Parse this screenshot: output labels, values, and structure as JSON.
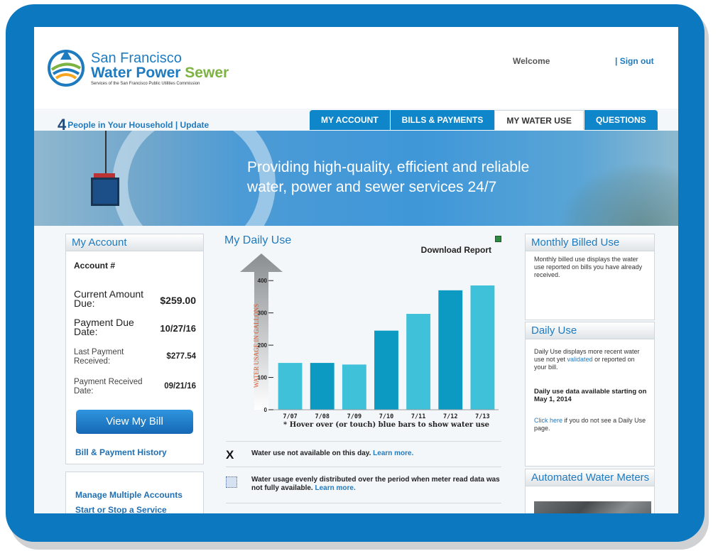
{
  "colors": {
    "frame_blue": "#0b78bf",
    "accent": "#1f7bc0",
    "tab_blue": "#0f86c9",
    "bar_light": "#3ec1d9",
    "bar_dark": "#0c9ac2"
  },
  "header": {
    "logo_line1": "San Francisco",
    "logo_word1": "Water",
    "logo_word2": "Power",
    "logo_word3": "Sewer",
    "logo_tagline": "Services of the San Francisco Public Utilities Commission",
    "welcome": "Welcome",
    "sign_out": "| Sign out",
    "household_count": "4",
    "household_text": "People in Your Household | Update"
  },
  "tabs": [
    {
      "label": "MY ACCOUNT"
    },
    {
      "label": "BILLS & PAYMENTS"
    },
    {
      "label": "MY WATER USE"
    },
    {
      "label": "QUESTIONS"
    }
  ],
  "banner": {
    "line1": "Providing high-quality, efficient and reliable",
    "line2": "water, power and sewer services 24/7"
  },
  "my_account": {
    "title": "My Account",
    "account_label": "Account #",
    "rows": [
      {
        "label": "Current Amount Due:",
        "value": "$259.00"
      },
      {
        "label": "Payment Due Date:",
        "value": "10/27/16"
      },
      {
        "label": "Last Payment Received:",
        "value": "$277.54"
      },
      {
        "label": "Payment Received Date:",
        "value": "09/21/16"
      }
    ],
    "view_bill": "View My Bill",
    "bill_history": "Bill & Payment History",
    "manage_accounts": "Manage Multiple Accounts",
    "start_stop": "Start or Stop a Service"
  },
  "daily_use": {
    "title": "My Daily Use",
    "download": "Download Report",
    "hover_note": "* Hover over (or touch) blue bars to show water use",
    "note1_mark": "X",
    "note1_text": "Water use not available on this day.",
    "note1_link": "Learn more.",
    "note2_text": "Water usage evenly distributed over the period when meter read data was not fully available.",
    "note2_link": "Learn more."
  },
  "chart_data": {
    "type": "bar",
    "ylabel": "WATER USAGE IN GALLONS",
    "categories": [
      "7/07",
      "7/08",
      "7/09",
      "7/10",
      "7/11",
      "7/12",
      "7/13"
    ],
    "values": [
      145,
      145,
      140,
      245,
      297,
      370,
      385
    ],
    "yticks": [
      0,
      100,
      200,
      300,
      400
    ],
    "ylim": [
      0,
      440
    ]
  },
  "right": {
    "monthly_title": "Monthly Billed Use",
    "monthly_text": "Monthly billed use displays the water use reported on bills you have already received.",
    "daily_title": "Daily Use",
    "daily_text_a": "Daily Use displays more recent water use not yet",
    "daily_link": "validated",
    "daily_text_b": "or reported on your bill.",
    "daily_bold": "Daily use data available starting on May 1, 2014",
    "click_here": "Click here",
    "click_rest": "if you do not see a Daily Use page.",
    "meters_title": "Automated Water Meters"
  }
}
